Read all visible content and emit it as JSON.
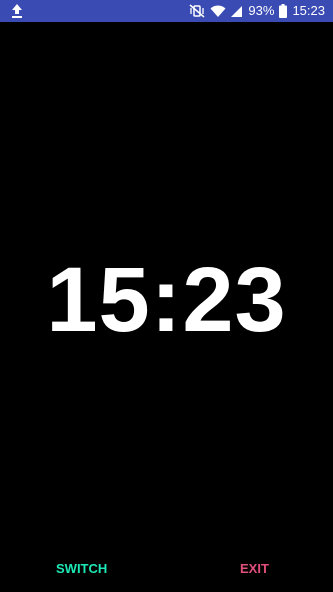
{
  "status_bar": {
    "upload_icon": "upload-arrow-icon",
    "mute_icon": "vibrate-off-icon",
    "wifi_icon": "wifi-icon",
    "signal_icon": "cell-signal-icon",
    "battery_percent": "93%",
    "battery_icon": "battery-icon",
    "time": "15:23",
    "background_color": "#3a4bb3"
  },
  "clock": {
    "time": "15:23"
  },
  "actions": {
    "switch_label": "SWITCH",
    "exit_label": "EXIT",
    "switch_color": "#1de9b6",
    "exit_color": "#e0507a"
  }
}
